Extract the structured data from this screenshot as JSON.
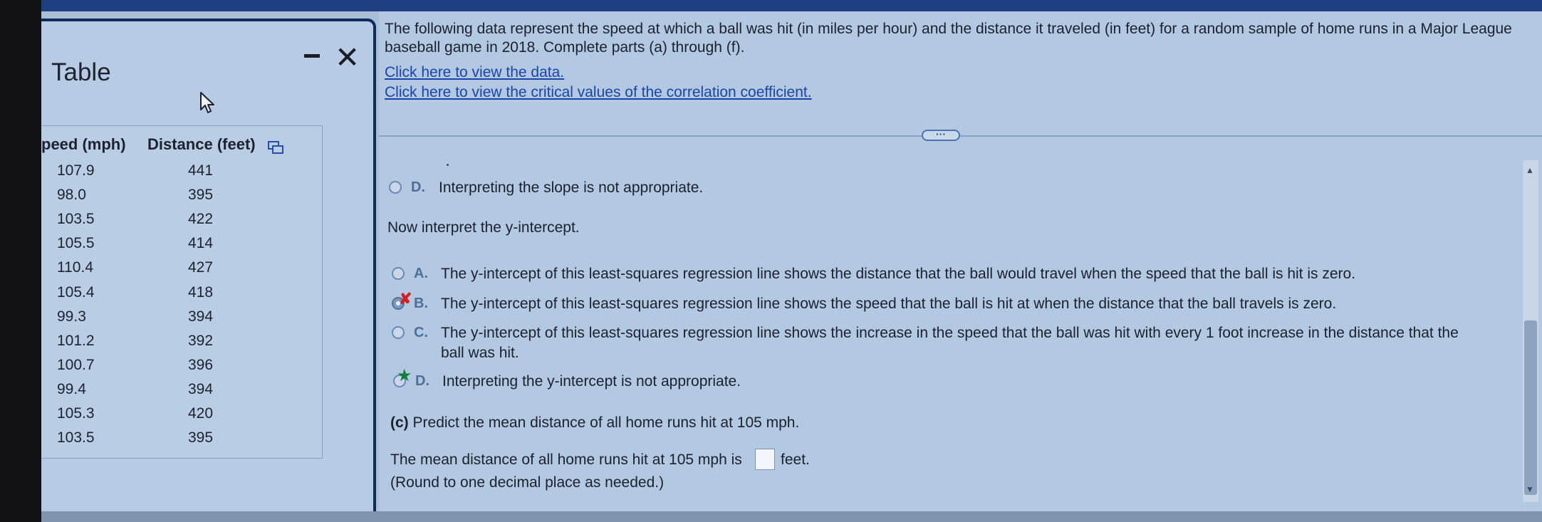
{
  "popup": {
    "title": "Table",
    "columns": [
      "peed (mph)",
      "Distance (feet)"
    ],
    "rows": [
      [
        "107.9",
        "441"
      ],
      [
        "98.0",
        "395"
      ],
      [
        "103.5",
        "422"
      ],
      [
        "105.5",
        "414"
      ],
      [
        "110.4",
        "427"
      ],
      [
        "105.4",
        "418"
      ],
      [
        "99.3",
        "394"
      ],
      [
        "101.2",
        "392"
      ],
      [
        "100.7",
        "396"
      ],
      [
        "99.4",
        "394"
      ],
      [
        "105.3",
        "420"
      ],
      [
        "103.5",
        "395"
      ]
    ]
  },
  "question": {
    "text": "The following data represent the speed at which a ball was hit (in miles per hour) and the distance it traveled (in feet) for a random sample of home runs in a Major League baseball game in 2018. Complete parts (a) through (f).",
    "link_data": "Click here to view the data.",
    "link_critical": "Click here to view the critical values of the correlation coefficient."
  },
  "slope": {
    "option_d_letter": "D.",
    "option_d_text": "Interpreting the slope is not appropriate."
  },
  "intercept": {
    "prompt": "Now interpret the y-intercept.",
    "options": [
      {
        "letter": "A.",
        "text": "The y-intercept of this least-squares regression line shows the distance that the ball would travel when the speed that the ball is hit is zero."
      },
      {
        "letter": "B.",
        "text": "The y-intercept of this least-squares regression line shows the speed that the ball is hit at when the distance that the ball travels is zero."
      },
      {
        "letter": "C.",
        "text": "The y-intercept of this least-squares regression line shows the increase in the speed that the ball was hit with every 1 foot increase in the distance that the",
        "text2": "ball was hit."
      },
      {
        "letter": "D.",
        "text": "Interpreting the y-intercept is not appropriate."
      }
    ],
    "selected": "B",
    "correct": "D"
  },
  "part_c": {
    "label": "(c)",
    "prompt": "Predict the mean distance of all home runs hit at 105 mph.",
    "answer_prefix": "The mean distance of all home runs hit at 105 mph is",
    "answer_suffix": "feet.",
    "hint": "(Round to one decimal place as needed.)"
  },
  "colors": {
    "accent": "#1c45a8",
    "wrong": "#d61f1f",
    "correct": "#14803a"
  },
  "icons": [
    "minimize-icon",
    "close-icon",
    "cursor-icon",
    "copy-icon",
    "cross-icon",
    "star-icon",
    "more-icon"
  ]
}
